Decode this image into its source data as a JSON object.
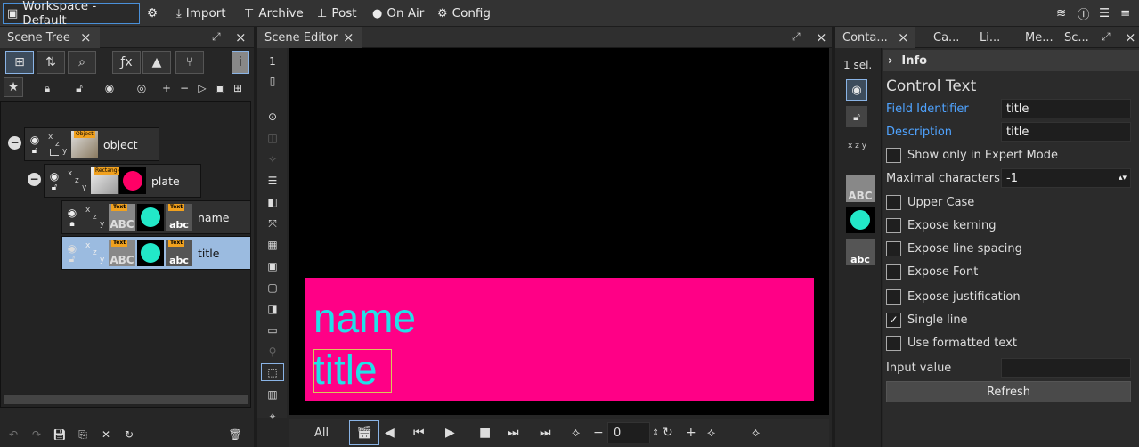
{
  "topbar": {
    "workspace": "Workspace - Default",
    "import": "Import",
    "archive": "Archive",
    "post": "Post",
    "on_air": "On Air",
    "config": "Config"
  },
  "scene_tree": {
    "tab": "Scene Tree",
    "nodes": [
      {
        "label": "object",
        "badge": "Object"
      },
      {
        "label": "plate",
        "badge": "Rectangle"
      },
      {
        "label": "name",
        "badge": "Text"
      },
      {
        "label": "title",
        "badge": "Text"
      }
    ]
  },
  "scene_editor": {
    "tab": "Scene Editor",
    "layer_num": "1",
    "canvas_name": "name",
    "canvas_title": "title",
    "colors": {
      "plate": "#ff0086",
      "text": "#22e0e8"
    },
    "player": {
      "all": "All",
      "frame": "0"
    }
  },
  "control": {
    "tabs": [
      "Conta...",
      "Ca...",
      "Li...",
      "Me...",
      "Sc..."
    ],
    "sel": "1 sel.",
    "info": "Info",
    "heading": "Control Text",
    "field_identifier_label": "Field Identifier",
    "field_identifier_value": "title",
    "description_label": "Description",
    "description_value": "title",
    "show_expert": "Show only in Expert Mode",
    "maximal_chars_label": "Maximal characters",
    "maximal_chars_value": "-1",
    "upper_case": "Upper Case",
    "expose_kerning": "Expose kerning",
    "expose_line_spacing": "Expose line spacing",
    "expose_font": "Expose Font",
    "expose_justification": "Expose justification",
    "single_line": "Single line",
    "use_formatted": "Use formatted text",
    "input_value_label": "Input value",
    "refresh": "Refresh"
  }
}
